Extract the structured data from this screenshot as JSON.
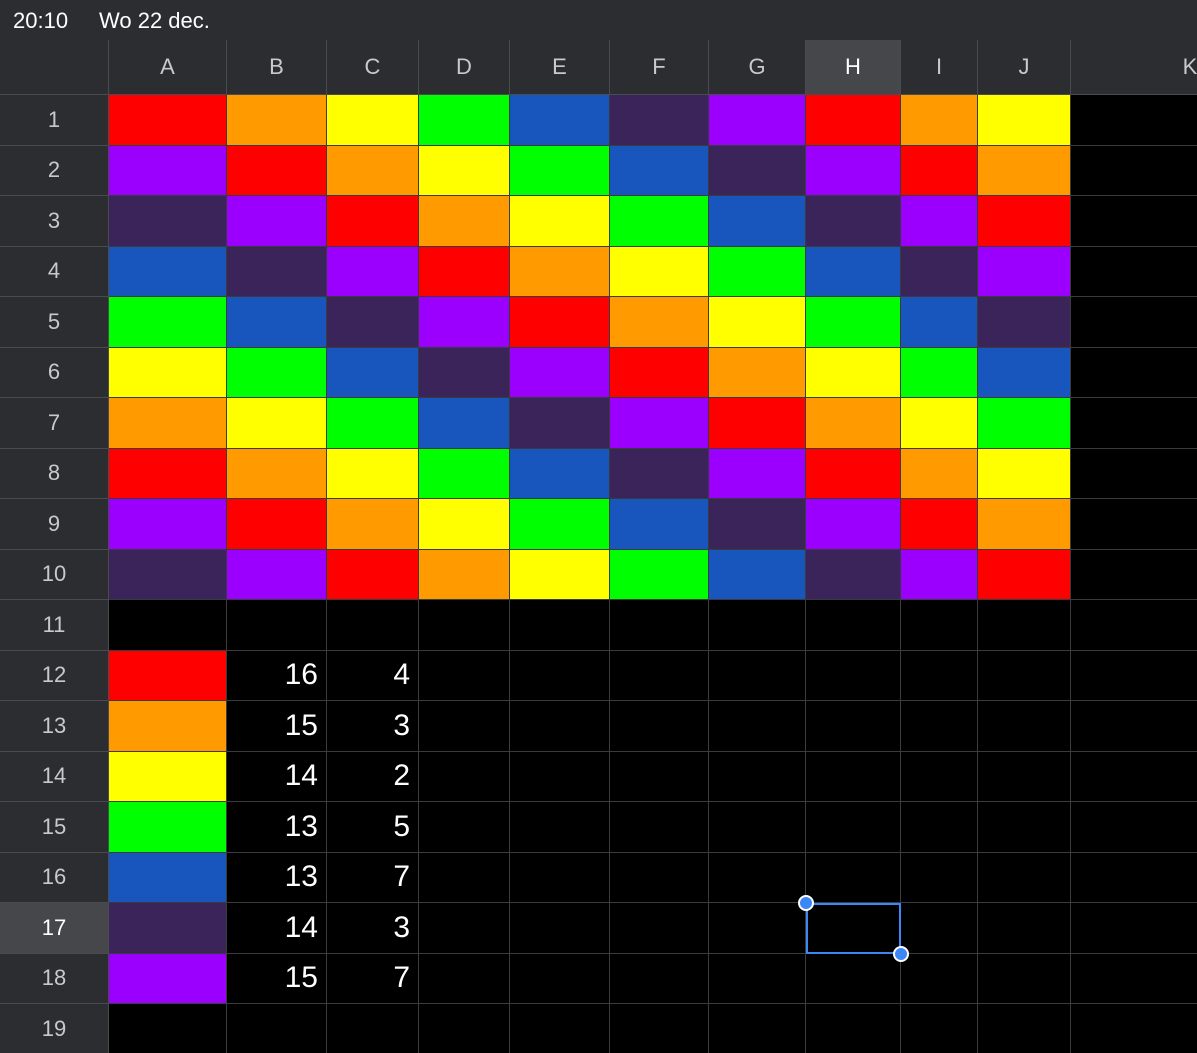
{
  "status_bar": {
    "time": "20:10",
    "date": "Wo 22 dec."
  },
  "sheet": {
    "columns": [
      "A",
      "B",
      "C",
      "D",
      "E",
      "F",
      "G",
      "H",
      "I",
      "J",
      "K"
    ],
    "rows": [
      "1",
      "2",
      "3",
      "4",
      "5",
      "6",
      "7",
      "8",
      "9",
      "10",
      "11",
      "12",
      "13",
      "14",
      "15",
      "16",
      "17",
      "18",
      "19"
    ],
    "selected_column": "H",
    "selected_row": "17",
    "selected_cell": "H17",
    "palette": {
      "R": "#ff0000",
      "O": "#ff9a00",
      "Y": "#ffff00",
      "G": "#00ff00",
      "B": "#1856bd",
      "N": "#3a2459",
      "P": "#9b00ff"
    },
    "color_grid": [
      [
        "R",
        "O",
        "Y",
        "G",
        "B",
        "N",
        "P",
        "R",
        "O",
        "Y"
      ],
      [
        "P",
        "R",
        "O",
        "Y",
        "G",
        "B",
        "N",
        "P",
        "R",
        "O"
      ],
      [
        "N",
        "P",
        "R",
        "O",
        "Y",
        "G",
        "B",
        "N",
        "P",
        "R"
      ],
      [
        "B",
        "N",
        "P",
        "R",
        "O",
        "Y",
        "G",
        "B",
        "N",
        "P"
      ],
      [
        "G",
        "B",
        "N",
        "P",
        "R",
        "O",
        "Y",
        "G",
        "B",
        "N"
      ],
      [
        "Y",
        "G",
        "B",
        "N",
        "P",
        "R",
        "O",
        "Y",
        "G",
        "B"
      ],
      [
        "O",
        "Y",
        "G",
        "B",
        "N",
        "P",
        "R",
        "O",
        "Y",
        "G"
      ],
      [
        "R",
        "O",
        "Y",
        "G",
        "B",
        "N",
        "P",
        "R",
        "O",
        "Y"
      ],
      [
        "P",
        "R",
        "O",
        "Y",
        "G",
        "B",
        "N",
        "P",
        "R",
        "O"
      ],
      [
        "N",
        "P",
        "R",
        "O",
        "Y",
        "G",
        "B",
        "N",
        "P",
        "R"
      ]
    ],
    "summary": [
      {
        "color": "R",
        "b": "16",
        "c": "4"
      },
      {
        "color": "O",
        "b": "15",
        "c": "3"
      },
      {
        "color": "Y",
        "b": "14",
        "c": "2"
      },
      {
        "color": "G",
        "b": "13",
        "c": "5"
      },
      {
        "color": "B",
        "b": "13",
        "c": "7"
      },
      {
        "color": "N",
        "b": "14",
        "c": "3"
      },
      {
        "color": "P",
        "b": "15",
        "c": "7"
      }
    ]
  }
}
